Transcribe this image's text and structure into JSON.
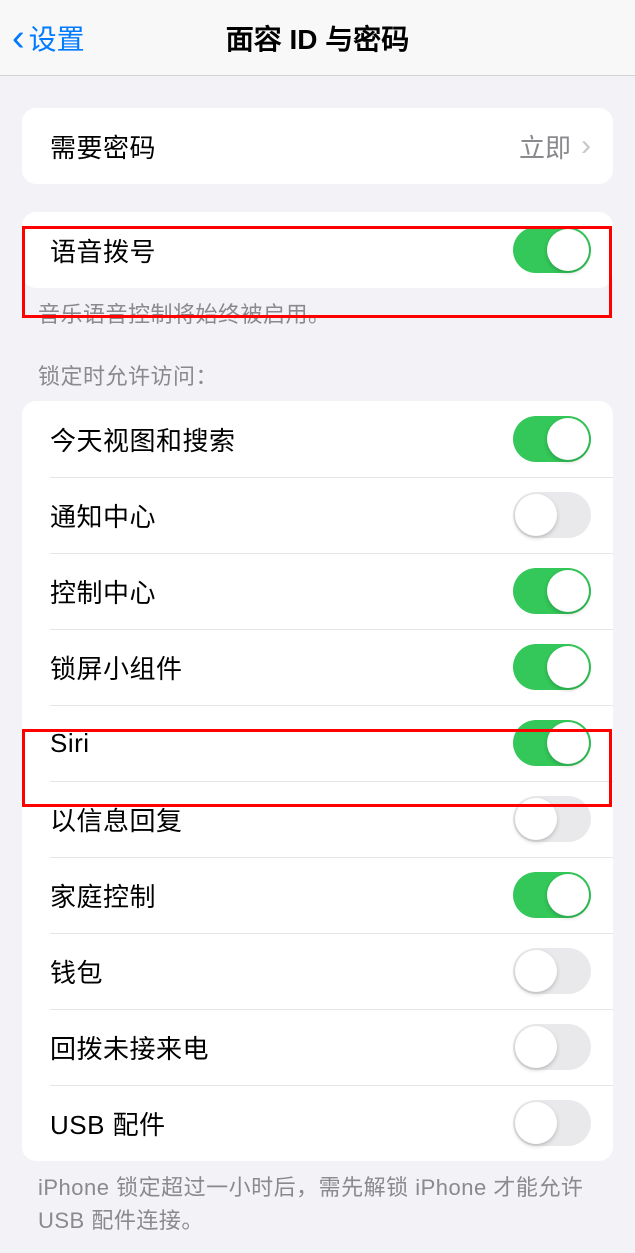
{
  "header": {
    "back_label": "设置",
    "title": "面容 ID 与密码"
  },
  "group_passcode": {
    "row": {
      "label": "需要密码",
      "value": "立即"
    }
  },
  "group_voice": {
    "row": {
      "label": "语音拨号",
      "on": true
    },
    "footer": "音乐语音控制将始终被启用。"
  },
  "group_lock": {
    "header": "锁定时允许访问：",
    "footer": "iPhone 锁定超过一小时后，需先解锁 iPhone 才能允许USB 配件连接。",
    "items": [
      {
        "label": "今天视图和搜索",
        "on": true
      },
      {
        "label": "通知中心",
        "on": false
      },
      {
        "label": "控制中心",
        "on": true
      },
      {
        "label": "锁屏小组件",
        "on": true
      },
      {
        "label": "Siri",
        "on": true
      },
      {
        "label": "以信息回复",
        "on": false
      },
      {
        "label": "家庭控制",
        "on": true
      },
      {
        "label": "钱包",
        "on": false
      },
      {
        "label": "回拨未接来电",
        "on": false
      },
      {
        "label": "USB 配件",
        "on": false
      }
    ]
  }
}
